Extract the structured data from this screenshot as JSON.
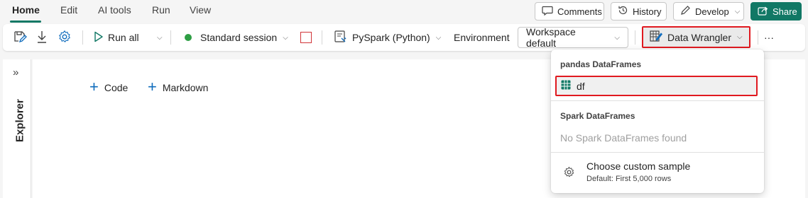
{
  "menu": {
    "tabs": [
      "Home",
      "Edit",
      "AI tools",
      "Run",
      "View"
    ],
    "active": "Home"
  },
  "top_actions": {
    "comments": "Comments",
    "history": "History",
    "develop": "Develop",
    "share": "Share"
  },
  "toolbar": {
    "run_all": "Run all",
    "session": "Standard session",
    "language": "PySpark (Python)",
    "environment_label": "Environment",
    "workspace": "Workspace default",
    "data_wrangler": "Data Wrangler",
    "more": "···"
  },
  "explorer": {
    "label": "Explorer",
    "expand_glyph": "»"
  },
  "canvas": {
    "add_code": "Code",
    "add_markdown": "Markdown"
  },
  "dropdown": {
    "pandas_header": "pandas DataFrames",
    "pandas_items": [
      "df"
    ],
    "spark_header": "Spark DataFrames",
    "spark_empty": "No Spark DataFrames found",
    "custom_title": "Choose custom sample",
    "custom_sub": "Default: First 5,000 rows"
  },
  "colors": {
    "accent": "#117865",
    "session_status": "#2e9e44",
    "highlight": "#e0191f",
    "link_blue": "#0f6cbd"
  }
}
